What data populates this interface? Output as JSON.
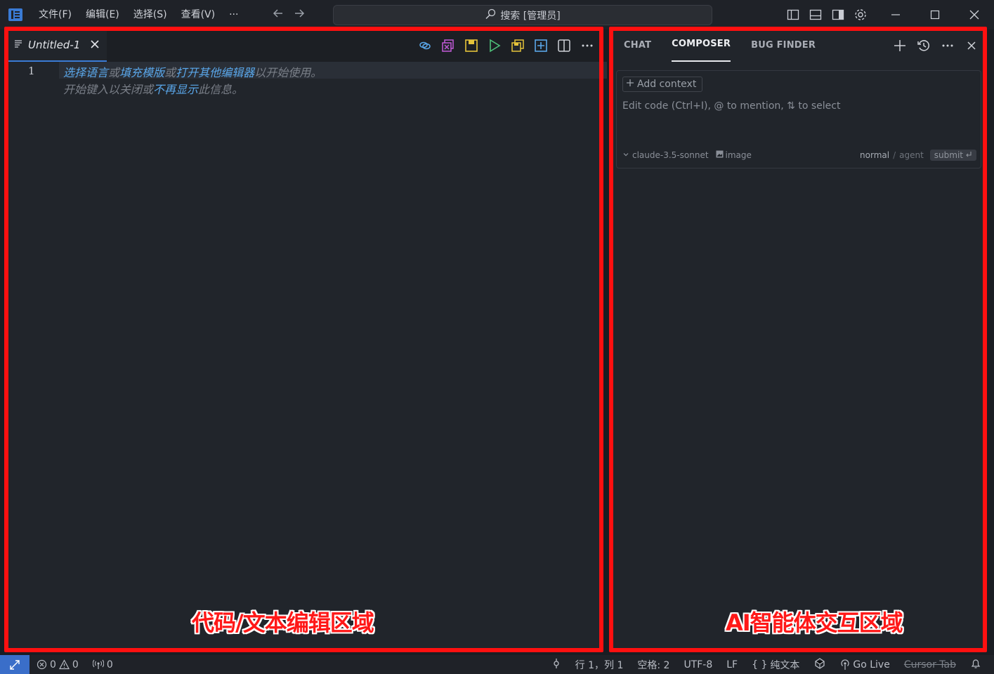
{
  "menu": {
    "items": [
      "文件(F)",
      "编辑(E)",
      "选择(S)",
      "查看(V)",
      "···"
    ]
  },
  "search": {
    "label": "搜索 [管理员]"
  },
  "editor": {
    "tab_title": "Untitled-1",
    "line_number": "1",
    "hint_line1": {
      "select_language": "选择语言",
      "or1": "或",
      "fill_template": "填充模版",
      "or2": "或",
      "open_other_editor": "打开其他编辑器",
      "to_start": "以开始使用。"
    },
    "hint_line2": {
      "start_typing": "开始键入以关闭或",
      "dont_show_again": "不再显示",
      "this_message": "此信息。"
    }
  },
  "ai_panel": {
    "tabs": [
      "CHAT",
      "COMPOSER",
      "BUG FINDER"
    ],
    "active_tab": "COMPOSER",
    "add_context": "Add context",
    "placeholder": "Edit code (Ctrl+I), @ to mention, ⇅ to select",
    "model": "claude-3.5-sonnet",
    "image_label": "image",
    "mode_normal": "normal",
    "mode_sep": "/",
    "mode_agent": "agent",
    "submit": "submit"
  },
  "annotations": {
    "editor_area": "代码/文本编辑区域",
    "ai_area": "AI智能体交互区域",
    "frame_color": "#ff1010"
  },
  "statusbar": {
    "errors": "0",
    "warnings": "0",
    "ports": "0",
    "position": "行 1，列 1",
    "spaces": "空格: 2",
    "encoding": "UTF-8",
    "eol": "LF",
    "language": "纯文本",
    "go_live": "Go Live",
    "cursor_tab": "Cursor Tab"
  },
  "colors": {
    "accent": "#3a7bd5",
    "link": "#5aa7ea",
    "remote": "#3a6ec9"
  }
}
